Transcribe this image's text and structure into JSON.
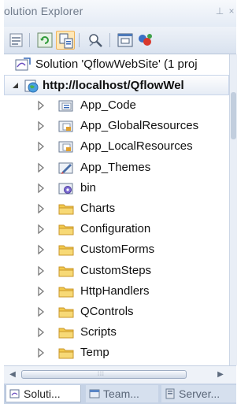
{
  "window": {
    "title": "olution Explorer",
    "pin_glyph": "⊥",
    "close_glyph": "×"
  },
  "toolbar": {
    "buttons": [
      {
        "name": "properties-icon",
        "active": false
      },
      {
        "name": "refresh-icon",
        "active": false
      },
      {
        "name": "nest-related-files-icon",
        "active": true
      },
      {
        "name": "view-code-icon",
        "active": false
      },
      {
        "name": "view-designer-icon",
        "active": false
      },
      {
        "name": "class-diagram-icon",
        "active": false
      }
    ]
  },
  "tree": {
    "solution": {
      "label": "Solution 'QflowWebSite' (1 proj",
      "icon": "solution-icon"
    },
    "project": {
      "label": "http://localhost/QflowWel",
      "icon": "website-icon",
      "expanded": true
    },
    "items": [
      {
        "label": "App_Code",
        "icon": "special-folder-icon"
      },
      {
        "label": "App_GlobalResources",
        "icon": "resource-folder-icon"
      },
      {
        "label": "App_LocalResources",
        "icon": "resource-folder-icon"
      },
      {
        "label": "App_Themes",
        "icon": "themes-folder-icon"
      },
      {
        "label": "bin",
        "icon": "bin-folder-icon"
      },
      {
        "label": "Charts",
        "icon": "folder-icon"
      },
      {
        "label": "Configuration",
        "icon": "folder-icon"
      },
      {
        "label": "CustomForms",
        "icon": "folder-icon"
      },
      {
        "label": "CustomSteps",
        "icon": "folder-icon"
      },
      {
        "label": "HttpHandlers",
        "icon": "folder-icon"
      },
      {
        "label": "QControls",
        "icon": "folder-icon"
      },
      {
        "label": "Scripts",
        "icon": "folder-icon"
      },
      {
        "label": "Temp",
        "icon": "folder-icon"
      }
    ]
  },
  "hscroll": {
    "left_glyph": "◀",
    "right_glyph": "▶",
    "grip": "⁞⁞⁞"
  },
  "tabs": [
    {
      "label": "Soluti...",
      "icon": "solution-explorer-icon",
      "selected": true
    },
    {
      "label": "Team...",
      "icon": "team-explorer-icon",
      "selected": false
    },
    {
      "label": "Server...",
      "icon": "server-explorer-icon",
      "selected": false
    }
  ],
  "colors": {
    "folder": "#f2c94c",
    "folder_dark": "#c9962a",
    "selection_border": "#c9d6ea",
    "panel_background": "#dfe7f3"
  }
}
